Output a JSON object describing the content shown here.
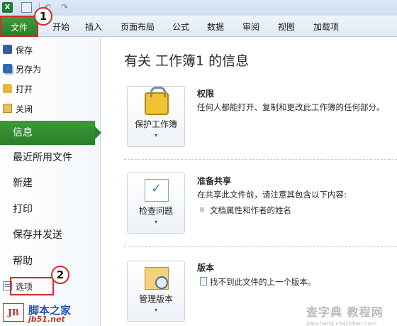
{
  "ribbon": {
    "file_tab": "文件",
    "tabs": [
      "开始",
      "插入",
      "页面布局",
      "公式",
      "数据",
      "审阅",
      "视图",
      "加载项"
    ]
  },
  "backstage": {
    "commands": {
      "save": "保存",
      "save_as": "另存为",
      "open": "打开",
      "close": "关闭"
    },
    "nav": {
      "info": "信息",
      "recent": "最近所用文件",
      "new": "新建",
      "print": "打印",
      "save_send": "保存并发送",
      "help": "帮助"
    },
    "options": "选项"
  },
  "annotations": {
    "marker1": "1",
    "marker2": "2"
  },
  "main": {
    "title": "有关 工作簿1 的信息",
    "permissions": {
      "button": "保护工作簿",
      "heading": "权限",
      "desc": "任何人都能打开、复制和更改此工作簿的任何部分。"
    },
    "prepare": {
      "button": "检查问题",
      "heading": "准备共享",
      "desc": "在共享此文件前，请注意其包含以下内容:",
      "bullet": "文档属性和作者的姓名"
    },
    "versions": {
      "button": "管理版本",
      "heading": "版本",
      "desc": "找不到此文件的上一个版本。"
    }
  },
  "watermarks": {
    "left_logo": "JB",
    "left_title": "脚本之家",
    "left_url": "jb51.net",
    "right_title": "查字典 教程网",
    "right_url": "jiaocheng.chazidian.com"
  },
  "colors": {
    "file_tab": "#2e842c",
    "highlight": "#d42b2b",
    "ribbon": "#dfe9f6"
  }
}
